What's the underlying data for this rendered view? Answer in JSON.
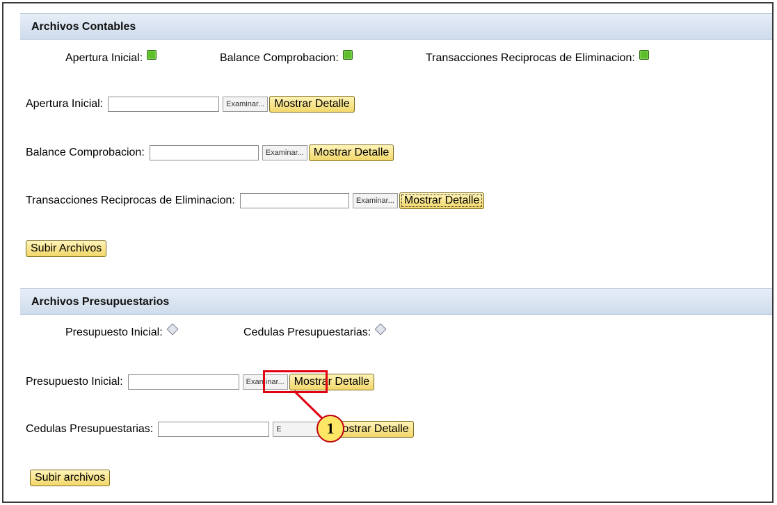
{
  "contables": {
    "header": "Archivos Contables",
    "status": [
      {
        "label": "Apertura Inicial:",
        "state": "green"
      },
      {
        "label": "Balance Comprobacion:",
        "state": "green"
      },
      {
        "label": "Transacciones Reciprocas de Eliminacion:",
        "state": "green"
      }
    ],
    "rows": [
      {
        "label": "Apertura Inicial:",
        "browse": "Examinar...",
        "button": "Mostrar Detalle"
      },
      {
        "label": "Balance Comprobacion:",
        "browse": "Examinar...",
        "button": "Mostrar Detalle"
      },
      {
        "label": "Transacciones Reciprocas de Eliminacion:",
        "browse": "Examinar...",
        "button": "Mostrar Detalle"
      }
    ],
    "upload_button": "Subir Archivos"
  },
  "presupuestarios": {
    "header": "Archivos Presupuestarios",
    "status": [
      {
        "label": "Presupuesto Inicial:",
        "state": "gray"
      },
      {
        "label": "Cedulas Presupuestarias:",
        "state": "gray"
      }
    ],
    "rows": [
      {
        "label": "Presupuesto Inicial:",
        "browse": "Examinar...",
        "button": "Mostrar Detalle"
      },
      {
        "label": "Cedulas Presupuestarias:",
        "browse": "E",
        "button": "Mostrar Detalle"
      }
    ],
    "upload_button": "Subir archivos"
  },
  "annotation": {
    "step_number": "1",
    "highlight_color": "#e00010"
  }
}
